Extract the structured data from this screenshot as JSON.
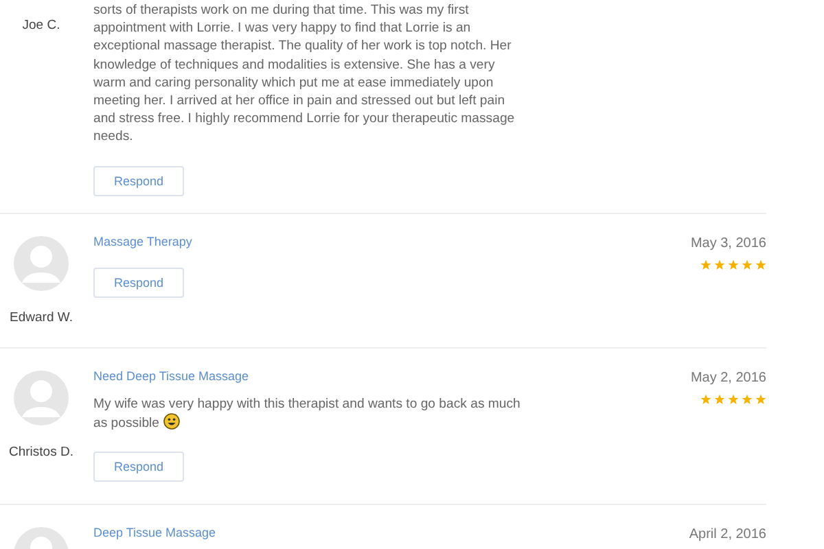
{
  "reviews": [
    {
      "name": "Joe C.",
      "avatar": false,
      "text": "sorts of therapists work on me during that time. This was my first appointment with Lorrie. I was very happy to find that Lorrie is an exceptional massage therapist. The quality of her work is top notch. Her knowledge of techniques and modalities is extensive. She has a very warm and caring personality which put me at ease immediately upon meeting her. I arrived at her office in pain and stressed out but left pain and stress free. I highly recommend Lorrie for your therapeutic massage needs.",
      "button": "Respond"
    },
    {
      "name": "Edward W.",
      "avatar": true,
      "title": "Massage Therapy",
      "date": "May 3, 2016",
      "stars": 5,
      "button": "Respond"
    },
    {
      "name": "Christos D.",
      "avatar": true,
      "title": "Need Deep Tissue Massage",
      "date": "May 2, 2016",
      "stars": 5,
      "text": "My wife was very happy with this therapist and wants to go back as much as possible",
      "emoji": true,
      "button": "Respond"
    },
    {
      "avatar": true,
      "title": "Deep Tissue Massage",
      "date": "April 2, 2016"
    }
  ]
}
